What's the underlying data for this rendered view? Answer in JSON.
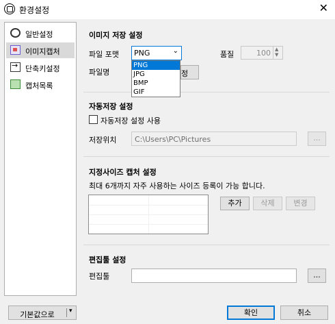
{
  "window": {
    "title": "환경설정",
    "close_glyph": "✕",
    "app_icon": "capture-icon"
  },
  "sidebar": {
    "items": [
      {
        "label": "일반설정",
        "icon": "gear-icon"
      },
      {
        "label": "이미지캡처",
        "icon": "image-capture-icon"
      },
      {
        "label": "단축키설정",
        "icon": "shortcut-icon"
      },
      {
        "label": "캡처목록",
        "icon": "capture-list-icon"
      }
    ],
    "selected": "이미지캡처"
  },
  "image_save": {
    "title": "이미지 저장 설정",
    "format_label": "파일 포맷",
    "format_value": "PNG",
    "format_options": [
      "PNG",
      "JPG",
      "BMP",
      "GIF"
    ],
    "quality_label": "품질",
    "quality_value": "100",
    "filename_label": "파일명",
    "hidden_button_label": "정"
  },
  "auto_save": {
    "title": "자동저장 설정",
    "checkbox_label": "자동저장 설정 사용",
    "checked": false,
    "location_label": "저장위치",
    "location_value": "C:\\Users\\PC\\Pictures",
    "browse_label": "..."
  },
  "size_capture": {
    "title": "지정사이즈 캡처 설정",
    "description": "최대 6개까지 자주 사용하는 사이즈 등록이 가능 합니다.",
    "add_label": "추가",
    "delete_label": "삭제",
    "change_label": "변경"
  },
  "editor": {
    "title": "편집툴 설정",
    "label": "편집툴",
    "value": "",
    "browse_label": "..."
  },
  "footer": {
    "defaults_label": "기본값으로",
    "defaults_arrow": "▾",
    "ok_label": "확인",
    "cancel_label": "취소"
  }
}
